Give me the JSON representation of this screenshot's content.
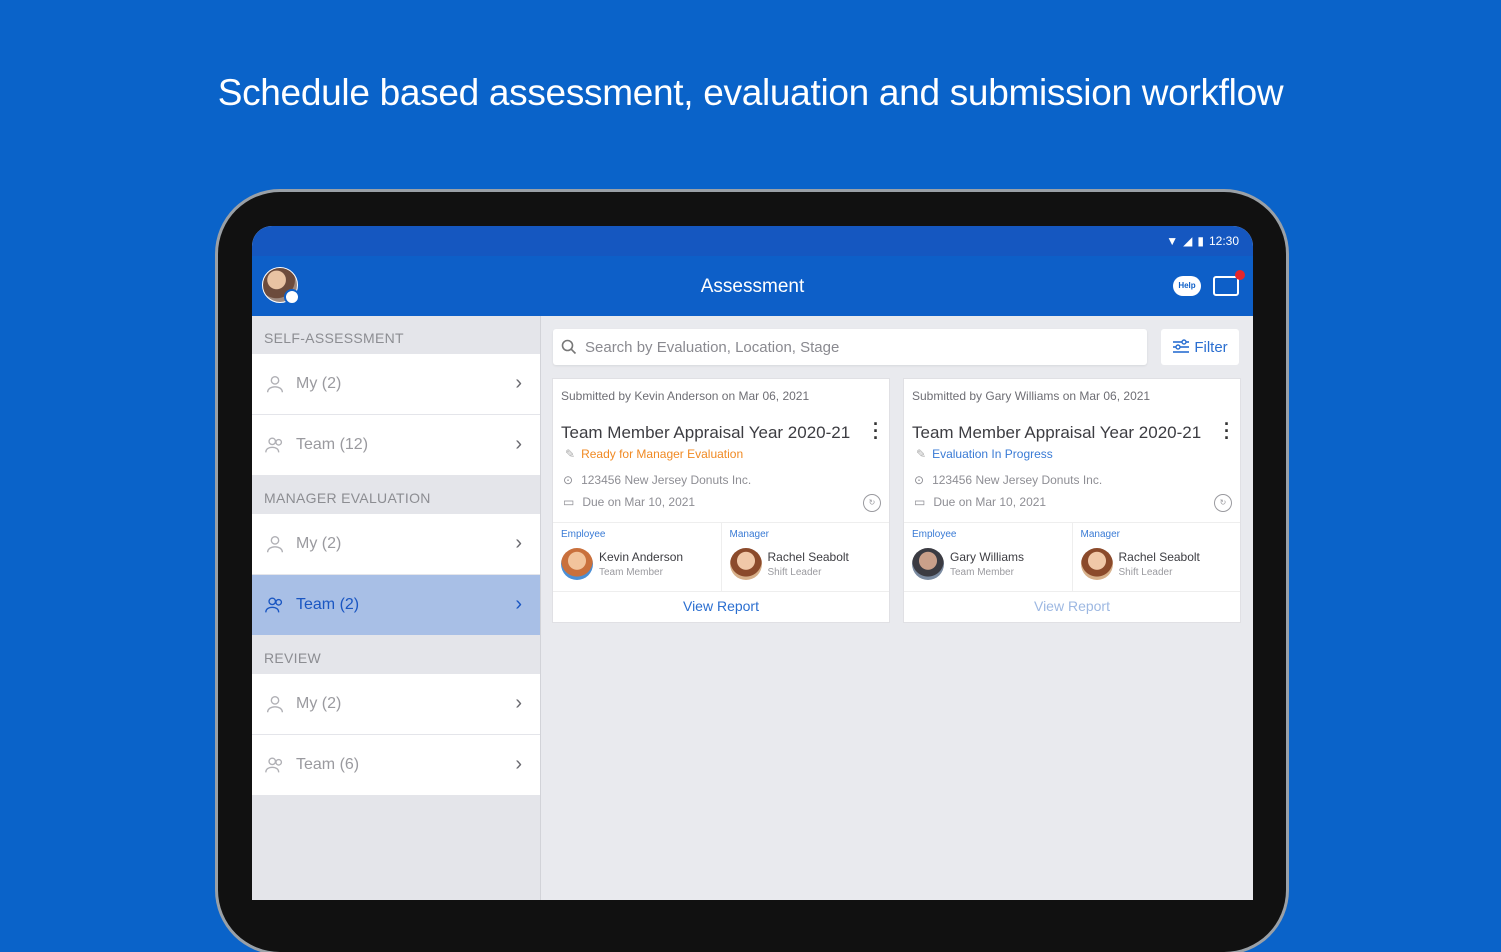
{
  "headline": "Schedule based assessment, evaluation and submission workflow",
  "status_bar": {
    "time": "12:30"
  },
  "app_bar": {
    "title": "Assessment",
    "help_label": "Help"
  },
  "sidebar": {
    "sections": [
      {
        "header": "SELF-ASSESSMENT",
        "items": [
          {
            "label": "My (2)"
          },
          {
            "label": "Team (12)"
          }
        ]
      },
      {
        "header": "MANAGER EVALUATION",
        "items": [
          {
            "label": "My (2)"
          },
          {
            "label": "Team (2)"
          }
        ]
      },
      {
        "header": "REVIEW",
        "items": [
          {
            "label": "My (2)"
          },
          {
            "label": "Team (6)"
          }
        ]
      }
    ]
  },
  "search": {
    "placeholder": "Search by Evaluation, Location, Stage"
  },
  "filter": {
    "label": "Filter"
  },
  "cards": [
    {
      "submitted": "Submitted by Kevin Anderson on Mar 06, 2021",
      "title": "Team Member Appraisal Year 2020-21",
      "status": "Ready for Manager Evaluation",
      "status_color": "#f08a24",
      "location": "123456 New Jersey Donuts Inc.",
      "due": "Due on Mar 10, 2021",
      "employee": {
        "role": "Employee",
        "name": "Kevin Anderson",
        "title": "Team Member"
      },
      "manager": {
        "role": "Manager",
        "name": "Rachel Seabolt",
        "title": "Shift Leader"
      },
      "view_report": "View Report"
    },
    {
      "submitted": "Submitted by Gary Williams on Mar 06, 2021",
      "title": "Team Member Appraisal Year 2020-21",
      "status": "Evaluation In Progress",
      "status_color": "#3a7bd5",
      "location": "123456 New Jersey Donuts Inc.",
      "due": "Due on Mar 10, 2021",
      "employee": {
        "role": "Employee",
        "name": "Gary Williams",
        "title": "Team Member"
      },
      "manager": {
        "role": "Manager",
        "name": "Rachel Seabolt",
        "title": "Shift Leader"
      },
      "view_report": "View Report"
    }
  ]
}
